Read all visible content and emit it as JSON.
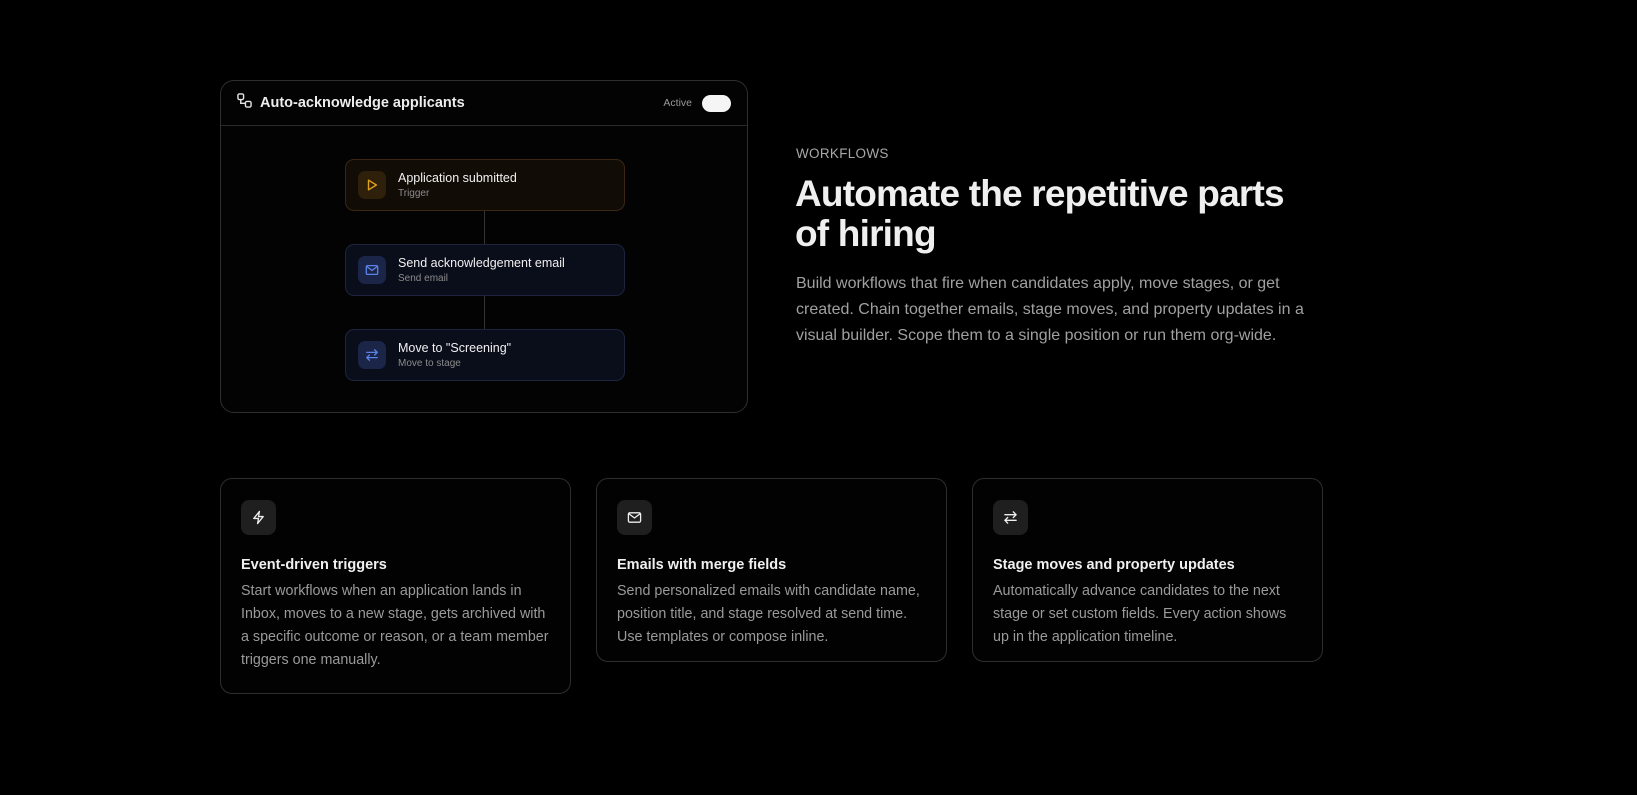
{
  "workflow": {
    "title": "Auto-acknowledge applicants",
    "status_label": "Active",
    "active": true,
    "nodes": [
      {
        "title": "Application submitted",
        "subtitle": "Trigger",
        "icon": "play-icon",
        "color": "#e0a21e"
      },
      {
        "title": "Send acknowledgement email",
        "subtitle": "Send email",
        "icon": "mail-icon",
        "color": "#5b82e6"
      },
      {
        "title": "Move to \"Screening\"",
        "subtitle": "Move to stage",
        "icon": "arrows-swap-icon",
        "color": "#5b82e6"
      }
    ]
  },
  "hero": {
    "eyebrow": "WORKFLOWS",
    "heading": "Automate the repetitive parts of hiring",
    "description": "Build workflows that fire when candidates apply, move stages, or get created. Chain together emails, stage moves, and property updates in a visual builder. Scope them to a single position or run them org-wide."
  },
  "features": [
    {
      "icon": "lightning-icon",
      "title": "Event-driven triggers",
      "description": "Start workflows when an application lands in Inbox, moves to a new stage, gets archived with a specific outcome or reason, or a team member triggers one manually."
    },
    {
      "icon": "mail-icon",
      "title": "Emails with merge fields",
      "description": "Send personalized emails with candidate name, position title, and stage resolved at send time. Use templates or compose inline."
    },
    {
      "icon": "arrows-swap-icon",
      "title": "Stage moves and property updates",
      "description": "Automatically advance candidates to the next stage or set custom fields. Every action shows up in the application timeline."
    }
  ]
}
